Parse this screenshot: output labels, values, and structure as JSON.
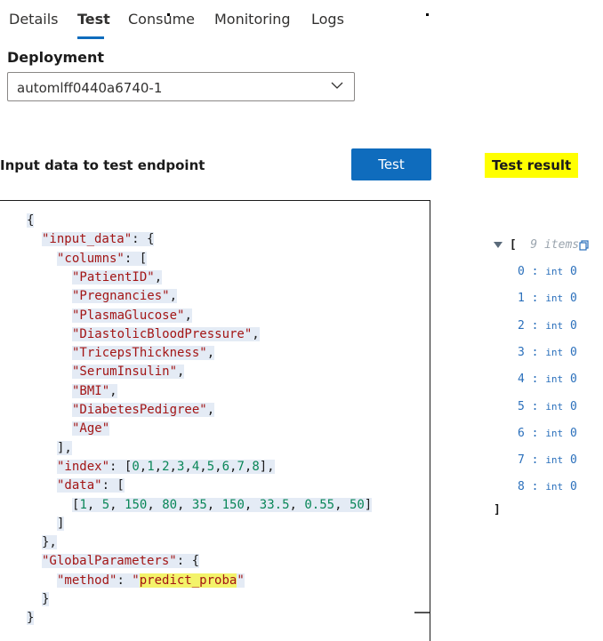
{
  "tabs": [
    {
      "label": "Details"
    },
    {
      "label": "Test"
    },
    {
      "label": "Consume"
    },
    {
      "label": "Monitoring"
    },
    {
      "label": "Logs"
    }
  ],
  "deployment": {
    "label": "Deployment",
    "selected": "automlff0440a6740-1"
  },
  "input_heading": "Input data to test endpoint",
  "test_button": "Test",
  "result_heading": "Test result",
  "code_lines": [
    "{",
    "\"input_data\": {",
    "\"columns\": [",
    "\"PatientID\",",
    "\"Pregnancies\",",
    "\"PlasmaGlucose\",",
    "\"DiastolicBloodPressure\",",
    "\"TricepsThickness\",",
    "\"SerumInsulin\",",
    "\"BMI\",",
    "\"DiabetesPedigree\",",
    "\"Age\"",
    "],",
    "\"index\": [0,1,2,3,4,5,6,7,8],",
    "\"data\": [",
    "[1, 5, 150, 80, 35, 150, 33.5, 0.55, 50]",
    "]",
    "},",
    "\"GlobalParameters\": {",
    "\"method\": \"predict_proba\"",
    "}",
    "}"
  ],
  "result": {
    "open_bracket": "[",
    "count_label": "9 items",
    "close_bracket": "]",
    "rows": [
      {
        "index": "0",
        "type": "int",
        "value": "0"
      },
      {
        "index": "1",
        "type": "int",
        "value": "0"
      },
      {
        "index": "2",
        "type": "int",
        "value": "0"
      },
      {
        "index": "3",
        "type": "int",
        "value": "0"
      },
      {
        "index": "4",
        "type": "int",
        "value": "0"
      },
      {
        "index": "5",
        "type": "int",
        "value": "0"
      },
      {
        "index": "6",
        "type": "int",
        "value": "0"
      },
      {
        "index": "7",
        "type": "int",
        "value": "0"
      },
      {
        "index": "8",
        "type": "int",
        "value": "0"
      }
    ]
  },
  "colors": {
    "accent": "#0f6cbd",
    "highlight": "#ffff00"
  }
}
